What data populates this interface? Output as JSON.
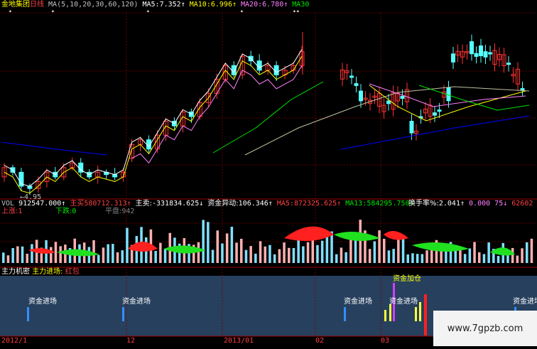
{
  "header": {
    "stock_name": "金地集团",
    "period": "日线",
    "ma_params": "MA(5,10,20,30,60,120)",
    "ma5_label": "MA5:",
    "ma5_value": "7.352↑",
    "ma10_label": "MA10:",
    "ma10_value": "6.996↑",
    "ma20_label": "MA20:",
    "ma20_value": "6.780↑",
    "ma30_label": "MA30",
    "markers": [
      "✦",
      "✦",
      "✦",
      "✦",
      "✦✦"
    ]
  },
  "price_panel": {
    "low_marker": "4.95",
    "colors": {
      "up": "#ff3232",
      "down": "#54ffff",
      "ma5": "#ffffff",
      "ma10": "#ffff00",
      "ma20": "#ff80ff",
      "ma30": "#00e600",
      "ma60": "#c0c0a0",
      "ma120": "#0000ff"
    }
  },
  "vol_panel": {
    "vol_label": "VOL",
    "vol_value": "912547.000↑",
    "zhumai_label": "主买",
    "zhumai_value": "580712.313↑",
    "zhumai2_label": "主卖:",
    "zhumai2_value": "-331834.625↓",
    "fund_label": "资金异动:",
    "fund_value": "106.346↑",
    "ma5_label": "MA5:",
    "ma5_value": "872325.625↑",
    "ma13_label": "MA13:",
    "ma13_value": "584295.750↑",
    "turnover_label": "换手率%:",
    "turnover_value": "2.041↑",
    "extra1": "0.000",
    "extra2": "75↓",
    "extra3": "62602",
    "up_count_label": "上涨:",
    "up_count": "1",
    "down_count_label": "下跌:",
    "down_count": "0",
    "flat_label": "平盘:",
    "flat_value": "942"
  },
  "indicator_panel": {
    "title1": "主力机密",
    "title2": "主力进场:",
    "title3": "红包",
    "signals": [
      "资金进场",
      "资金进场",
      "资金进场",
      "资金进场",
      "资金加仓",
      "资金进场"
    ]
  },
  "x_axis": {
    "labels": [
      "2012/1",
      "12",
      "2013/01",
      "02",
      "03"
    ]
  },
  "watermark": "www.7gpzb.com",
  "chart_data": {
    "type": "candlestick",
    "title": "金地集团 日线",
    "x_labels": [
      "2012/1",
      "12",
      "2013/01",
      "02",
      "03"
    ],
    "approx_candles": [
      {
        "o": 5.2,
        "c": 5.4
      },
      {
        "o": 5.4,
        "c": 5.3
      },
      {
        "o": 5.3,
        "c": 5.0
      },
      {
        "o": 5.0,
        "c": 4.95
      },
      {
        "o": 4.95,
        "c": 5.1
      },
      {
        "o": 5.1,
        "c": 5.3
      },
      {
        "o": 5.3,
        "c": 5.2
      },
      {
        "o": 5.2,
        "c": 5.4
      },
      {
        "o": 5.4,
        "c": 5.5
      },
      {
        "o": 5.5,
        "c": 5.3
      },
      {
        "o": 5.3,
        "c": 5.2
      },
      {
        "o": 5.2,
        "c": 5.3
      },
      {
        "o": 5.3,
        "c": 5.25
      },
      {
        "o": 5.25,
        "c": 5.2
      },
      {
        "o": 5.2,
        "c": 5.3
      },
      {
        "o": 5.6,
        "c": 5.9
      },
      {
        "o": 5.9,
        "c": 6.0
      },
      {
        "o": 6.0,
        "c": 5.8
      },
      {
        "o": 5.8,
        "c": 6.1
      },
      {
        "o": 6.1,
        "c": 6.4
      },
      {
        "o": 6.4,
        "c": 6.3
      },
      {
        "o": 6.3,
        "c": 6.6
      },
      {
        "o": 6.6,
        "c": 6.5
      },
      {
        "o": 6.5,
        "c": 6.8
      },
      {
        "o": 6.8,
        "c": 7.0
      },
      {
        "o": 7.0,
        "c": 7.3
      },
      {
        "o": 7.3,
        "c": 7.6
      },
      {
        "o": 7.6,
        "c": 7.4
      },
      {
        "o": 7.4,
        "c": 7.8
      },
      {
        "o": 7.8,
        "c": 7.7
      },
      {
        "o": 7.7,
        "c": 7.5
      },
      {
        "o": 7.5,
        "c": 7.6
      },
      {
        "o": 7.6,
        "c": 7.4
      },
      {
        "o": 7.4,
        "c": 7.5
      },
      {
        "o": 7.5,
        "c": 7.6
      },
      {
        "o": 7.6,
        "c": 7.9
      }
    ]
  }
}
